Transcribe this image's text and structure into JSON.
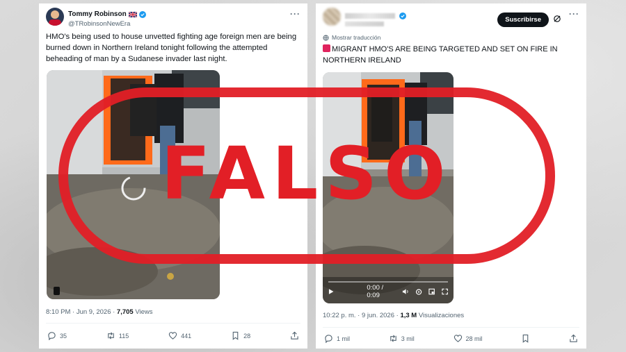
{
  "left_post": {
    "author_name": "Tommy Robinson",
    "author_handle": "@TRobinsonNewEra",
    "more_icon": "more-horizontal-icon",
    "text": "HMO's being used to house unvetted fighting age foreign men are being burned down in Northern Ireland tonight following the attempted beheading of man by a Sudanese invader last night.",
    "time": "8:10 PM · Jun 9, 2026 · ",
    "views_count": "7,705",
    "views_label": " Views",
    "replies": "35",
    "reposts": "115",
    "likes": "441",
    "bookmarks": "28"
  },
  "right_post": {
    "subscribe_label": "Suscribirse",
    "translate_label": "Mostrar traducción",
    "text": "MIGRANT HMO'S ARE BEING TARGETED AND SET ON FIRE IN NORTHERN IRELAND",
    "video_time": "0:00 / 0:09",
    "time": "10:22 p. m. · 9 jun. 2026 · ",
    "views_count": "1,3 M",
    "views_label": " Visualizaciones",
    "replies": "1 mil",
    "reposts": "3 mil",
    "likes": "28 mil"
  },
  "stamp": {
    "label": "FALSO",
    "color": "#e21f26"
  },
  "colors": {
    "verified": "#1d9bf0",
    "text_primary": "#0f1419",
    "text_secondary": "#536471"
  }
}
